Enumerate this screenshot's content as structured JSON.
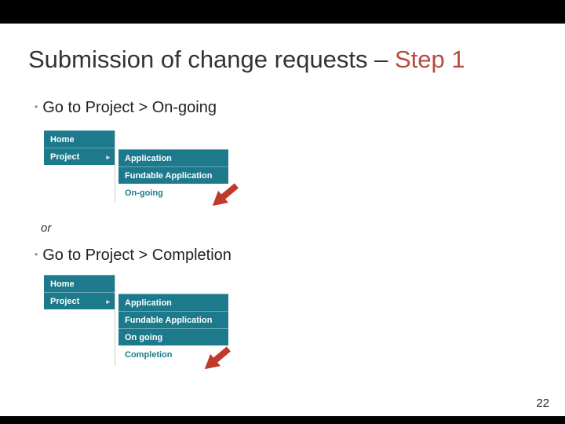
{
  "title": {
    "main": "Submission of change requests – ",
    "accent": "Step 1"
  },
  "bullet1": "Go to Project > On-going",
  "or": "or",
  "bullet2": "Go to Project > Completion",
  "menu1": {
    "left": [
      "Home",
      "Project"
    ],
    "right_teal": [
      "Application",
      "Fundable Application"
    ],
    "right_plain": [
      "On-going"
    ]
  },
  "menu2": {
    "left": [
      "Home",
      "Project"
    ],
    "right_teal": [
      "Application",
      "Fundable Application",
      "On going"
    ],
    "right_plain": [
      "Completion"
    ]
  },
  "page_number": "22",
  "colors": {
    "teal": "#1c7a8c",
    "accent_red": "#b84a3e",
    "arrow_red": "#c0392b"
  }
}
